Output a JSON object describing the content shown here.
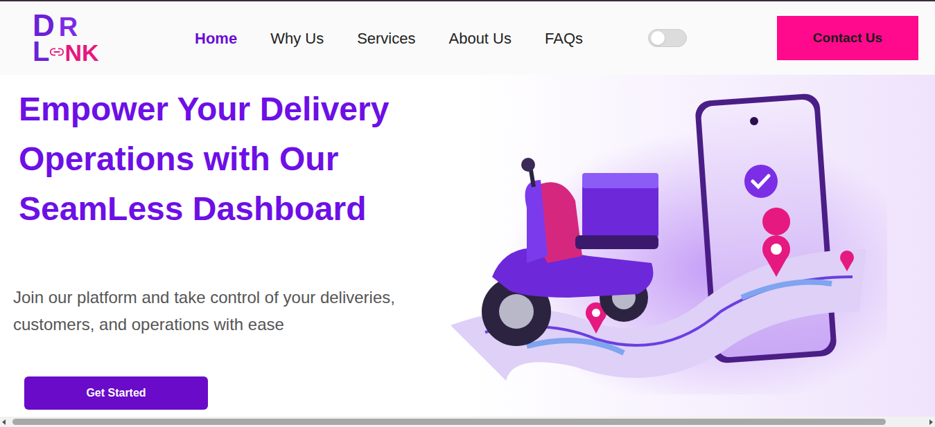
{
  "logo": {
    "top": [
      "D",
      "R"
    ],
    "bottom_left": "L",
    "bottom_right": "NK"
  },
  "nav": [
    {
      "label": "Home",
      "selected": true
    },
    {
      "label": "Why Us",
      "selected": false
    },
    {
      "label": "Services",
      "selected": false
    },
    {
      "label": "About Us",
      "selected": false
    },
    {
      "label": "FAQs",
      "selected": false
    }
  ],
  "theme_toggle": {
    "on": false
  },
  "contact_button": "Contact Us",
  "hero": {
    "heading": "Empower Your Delivery Operations with Our SeamLess Dashboard",
    "subtitle": "Join our platform and take control of your deliveries, customers, and operations with ease",
    "button": "Get Started"
  },
  "scrollbar": {
    "level": 0.96
  }
}
